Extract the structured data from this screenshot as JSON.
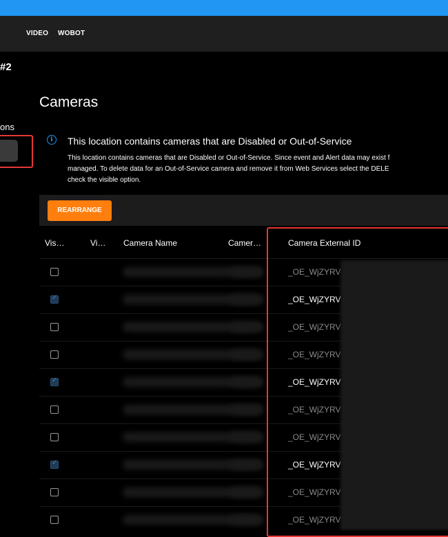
{
  "nav": {
    "items": [
      "VIDEO",
      "WOBOT"
    ]
  },
  "breadcrumb": "#2",
  "sidebar": {
    "label": "ons"
  },
  "page": {
    "title": "Cameras"
  },
  "alert": {
    "title": "This location contains cameras that are Disabled or Out-of-Service",
    "lines": [
      "This location contains cameras that are Disabled or Out-of-Service. Since event and Alert data may exist f",
      "managed. To delete data for an Out-of-Service camera and remove it from Web Services select the DELE",
      "check the visible option."
    ]
  },
  "toolbar": {
    "rearrange_label": "REARRANGE"
  },
  "table": {
    "columns": [
      "Vis…",
      "Vi…",
      "Camera Name",
      "Camer…",
      "Camera External ID"
    ],
    "rows": [
      {
        "visible": false,
        "external_id": "_OE_WjZYRV"
      },
      {
        "visible": true,
        "external_id": "_OE_WjZYRV"
      },
      {
        "visible": false,
        "external_id": "_OE_WjZYRV"
      },
      {
        "visible": false,
        "external_id": "_OE_WjZYRV"
      },
      {
        "visible": true,
        "external_id": "_OE_WjZYRV"
      },
      {
        "visible": false,
        "external_id": "_OE_WjZYRV"
      },
      {
        "visible": false,
        "external_id": "_OE_WjZYRV"
      },
      {
        "visible": true,
        "external_id": "_OE_WjZYRV"
      },
      {
        "visible": false,
        "external_id": "_OE_WjZYRV"
      },
      {
        "visible": false,
        "external_id": "_OE_WjZYRV"
      }
    ]
  },
  "colors": {
    "accent": "#2196f3",
    "button": "#ff7f0e",
    "highlight": "#e53935"
  }
}
